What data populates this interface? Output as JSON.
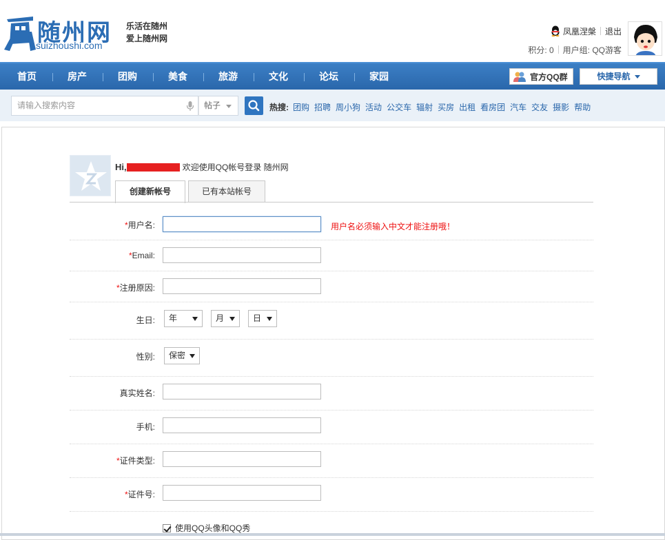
{
  "header": {
    "logo_cn": "随州网",
    "logo_en": "suizhoushi.com",
    "slogan_line1": "乐活在随州",
    "slogan_line2": "爱上随州网",
    "username": "凤凰涅槃",
    "logout": "退出",
    "points_label": "积分: 0",
    "usergroup_label": "用户组: QQ游客"
  },
  "nav": {
    "items": [
      "首页",
      "房产",
      "团购",
      "美食",
      "旅游",
      "文化",
      "论坛",
      "家园"
    ],
    "qq_group": "官方QQ群",
    "quick_nav": "快捷导航"
  },
  "search": {
    "placeholder": "请输入搜索内容",
    "type": "帖子",
    "hot_label": "热搜:",
    "hot_items": [
      "团购",
      "招聘",
      "周小狗",
      "活动",
      "公交车",
      "辐射",
      "买房",
      "出租",
      "看房团",
      "汽车",
      "交友",
      "摄影",
      "帮助"
    ]
  },
  "welcome": {
    "hi": "Hi,",
    "text": "欢迎使用QQ帐号登录 随州网"
  },
  "tabs": {
    "create": "创建新帐号",
    "existing": "已有本站帐号"
  },
  "form": {
    "username_label": "用户名:",
    "username_hint": "用户名必须输入中文才能注册哦！",
    "email_label": "Email:",
    "reason_label": "注册原因:",
    "birthday_label": "生日:",
    "year": "年",
    "month": "月",
    "day": "日",
    "gender_label": "性别:",
    "gender_value": "保密",
    "realname_label": "真实姓名:",
    "phone_label": "手机:",
    "idtype_label": "证件类型:",
    "idnum_label": "证件号:",
    "use_qq_avatar": "使用QQ头像和QQ秀",
    "required_mark": "*"
  }
}
